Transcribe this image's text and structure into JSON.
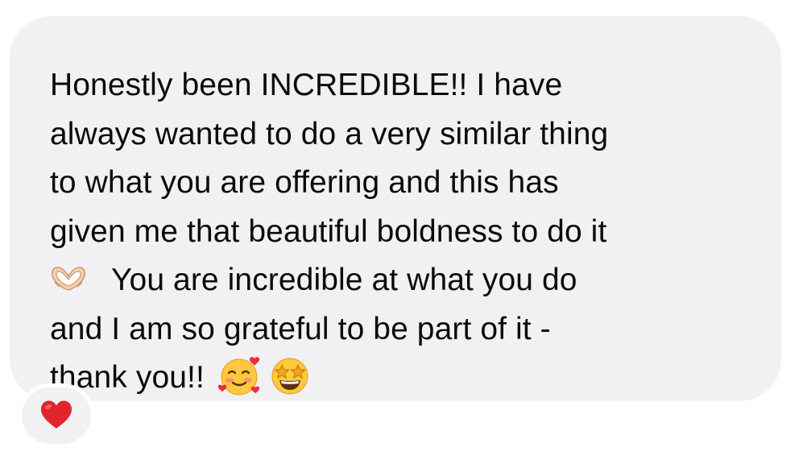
{
  "message": {
    "lines": [
      "Honestly been INCREDIBLE!! I have",
      "always wanted to do a very similar thing",
      "to what you are offering and this has",
      "given me that beautiful boldness to do it",
      "You are incredible at what you do",
      "and I am so grateful to be part of it -",
      "thank you!!"
    ],
    "emojis": {
      "heart_hands": "heart-hands",
      "smiling_hearts": "smiling-face-with-hearts",
      "star_struck": "star-struck"
    }
  },
  "reaction": {
    "emoji": "red-heart",
    "color": "#e0252d"
  },
  "colors": {
    "bubble": "#f1f1f4",
    "text": "#0b0b0b",
    "background": "#ffffff"
  }
}
